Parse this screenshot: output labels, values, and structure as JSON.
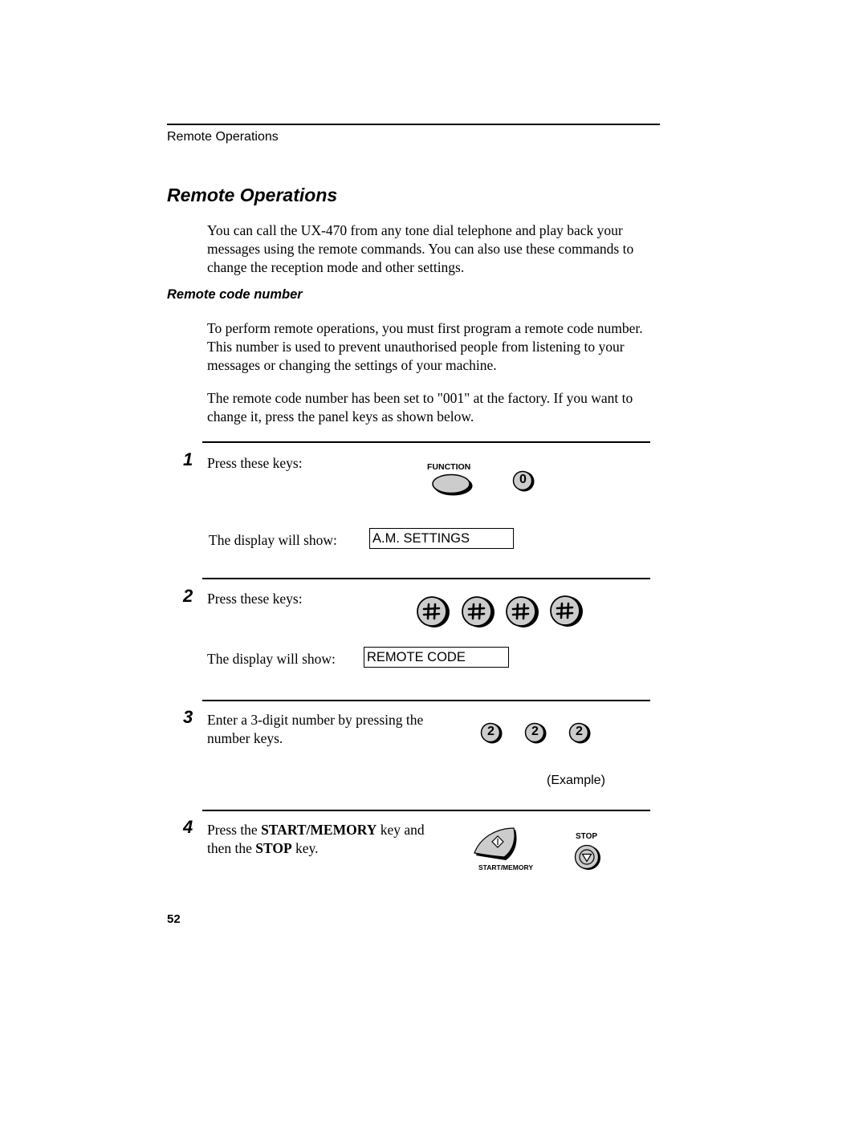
{
  "header": {
    "running_head": "Remote Operations"
  },
  "title": "Remote Operations",
  "intro": "You can call the UX-470 from any tone dial telephone and play back your messages using the remote commands. You can also use these commands to change the reception mode and other settings.",
  "section": {
    "heading": "Remote code number",
    "paragraphs": [
      "To perform remote operations, you must first program a remote code number. This number is used to prevent unauthorised people from listening to your messages or changing the settings of your machine.",
      "The remote code number has been set to \"001\" at the factory. If you want to change it, press the panel keys as shown below."
    ]
  },
  "steps": [
    {
      "number": "1",
      "text": "Press these keys:",
      "keys": [
        {
          "label": "FUNCTION",
          "icon": "function-key-icon"
        },
        {
          "label": "0",
          "icon": "number-key-icon"
        }
      ],
      "display_label": "The display will show:",
      "display_value": "A.M. SETTINGS"
    },
    {
      "number": "2",
      "text": "Press these keys:",
      "keys": [
        {
          "label": "#",
          "icon": "hash-key-icon"
        },
        {
          "label": "#",
          "icon": "hash-key-icon"
        },
        {
          "label": "#",
          "icon": "hash-key-icon"
        },
        {
          "label": "#",
          "icon": "hash-key-icon"
        }
      ],
      "display_label": "The display will show:",
      "display_value": "REMOTE CODE"
    },
    {
      "number": "3",
      "text_line1": "Enter a 3-digit number by pressing the",
      "text_line2": "number keys.",
      "keys": [
        {
          "label": "2",
          "icon": "number-key-icon"
        },
        {
          "label": "2",
          "icon": "number-key-icon"
        },
        {
          "label": "2",
          "icon": "number-key-icon"
        }
      ],
      "note": "(Example)"
    },
    {
      "number": "4",
      "text_pre1": "Press the ",
      "text_bold1": "START/MEMORY",
      "text_post1": " key and",
      "text_pre2": "then the ",
      "text_bold2": "STOP",
      "text_post2": " key.",
      "keys": [
        {
          "label": "START/MEMORY",
          "icon": "start-memory-key-icon"
        },
        {
          "label": "STOP",
          "icon": "stop-key-icon"
        }
      ]
    }
  ],
  "footer": {
    "page_number": "52"
  },
  "colors": {
    "key_fill": "#cccccc",
    "ink": "#000000"
  }
}
